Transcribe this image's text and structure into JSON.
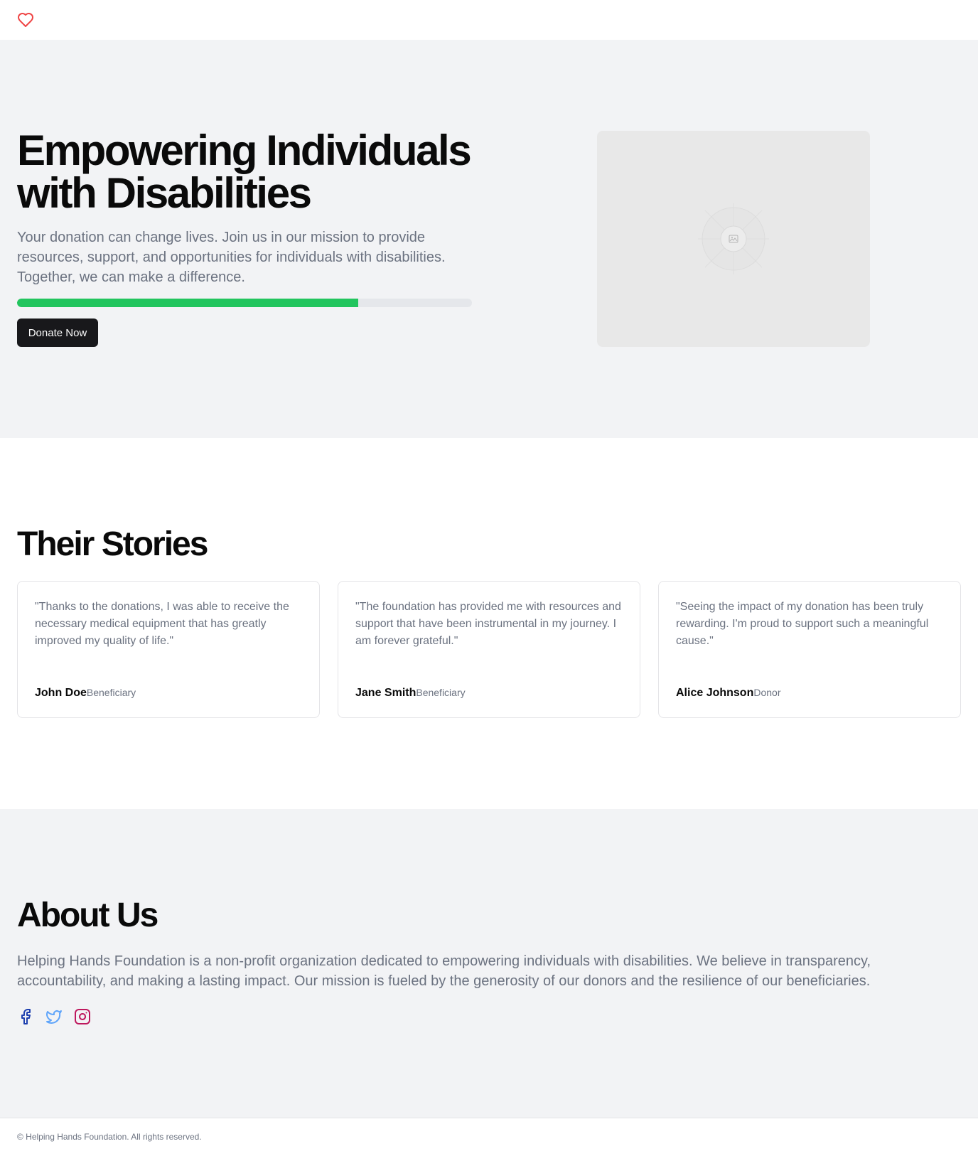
{
  "header": {
    "logo_icon": "heart-icon",
    "logo_color": "#ef4444"
  },
  "hero": {
    "title": "Empowering Individuals with Disabilities",
    "description": "Your donation can change lives. Join us in our mission to provide resources, support, and opportunities for individuals with disabilities. Together, we can make a difference.",
    "progress_percent": 75,
    "progress_color": "#22c55e",
    "donate_label": "Donate Now",
    "image_icon": "image-placeholder-icon"
  },
  "stories": {
    "title": "Their Stories",
    "items": [
      {
        "quote": "\"Thanks to the donations, I was able to receive the necessary medical equipment that has greatly improved my quality of life.\"",
        "name": "John Doe",
        "role": "Beneficiary"
      },
      {
        "quote": "\"The foundation has provided me with resources and support that have been instrumental in my journey. I am forever grateful.\"",
        "name": "Jane Smith",
        "role": "Beneficiary"
      },
      {
        "quote": "\"Seeing the impact of my donation has been truly rewarding. I'm proud to support such a meaningful cause.\"",
        "name": "Alice Johnson",
        "role": "Donor"
      }
    ]
  },
  "about": {
    "title": "About Us",
    "text": "Helping Hands Foundation is a non-profit organization dedicated to empowering individuals with disabilities. We believe in transparency, accountability, and making a lasting impact. Our mission is fueled by the generosity of our donors and the resilience of our beneficiaries.",
    "socials": [
      {
        "icon": "facebook-icon",
        "color": "#1e40af"
      },
      {
        "icon": "twitter-icon",
        "color": "#60a5fa"
      },
      {
        "icon": "instagram-icon",
        "color": "#be185d"
      }
    ]
  },
  "footer": {
    "text": "© Helping Hands Foundation. All rights reserved."
  }
}
